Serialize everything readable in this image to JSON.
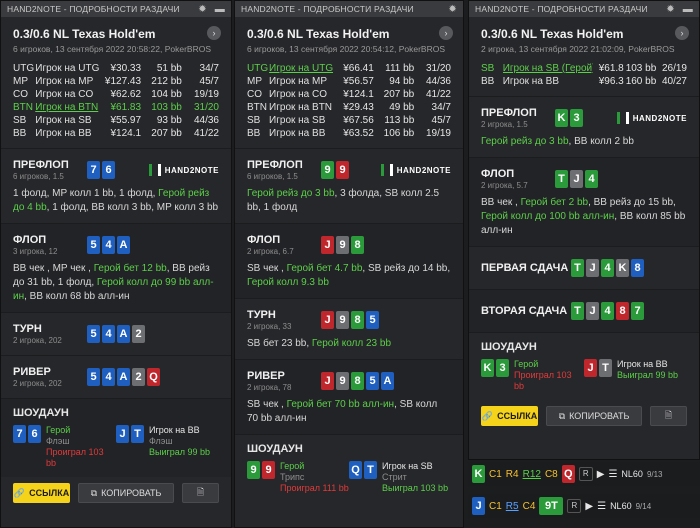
{
  "w1": {
    "title": "HAND2NOTE - ПОДРОБНОСТИ РАЗДАЧИ",
    "game": "0.3/0.6 NL Texas Hold'em",
    "meta": "6 игроков, 13 сентября 2022 20:58:22, PokerBROS",
    "players": [
      {
        "pos": "UTG",
        "name": "Игрок на UTG",
        "chips": "¥30.33",
        "bb": "51 bb",
        "stat": "34/7",
        "hero": false
      },
      {
        "pos": "MP",
        "name": "Игрок на MP",
        "chips": "¥127.43",
        "bb": "212 bb",
        "stat": "45/7",
        "hero": false
      },
      {
        "pos": "CO",
        "name": "Игрок на CO",
        "chips": "¥62.62",
        "bb": "104 bb",
        "stat": "19/19",
        "hero": false
      },
      {
        "pos": "BTN",
        "name": "Игрок на BTN",
        "chips": "¥61.83",
        "bb": "103 bb",
        "stat": "31/20",
        "hero": true
      },
      {
        "pos": "SB",
        "name": "Игрок на SB",
        "chips": "¥55.97",
        "bb": "93 bb",
        "stat": "44/36",
        "hero": false
      },
      {
        "pos": "BB",
        "name": "Игрок на BB",
        "chips": "¥124.1",
        "bb": "207 bb",
        "stat": "41/22",
        "hero": false
      }
    ],
    "preflop": {
      "label": "ПРЕФЛОП",
      "sub": "6 игроков, 1.5",
      "a1": "1 фолд, MP колл 1 bb, 1 фолд, ",
      "a2": "Герой рейз до 4 bb",
      "a3": ", 1 фолд, BB колл 3 bb, MP колл 3 bb"
    },
    "flop": {
      "label": "ФЛОП",
      "sub": "3 игрока, 12",
      "a1": "BB чек , MP чек , ",
      "a2": "Герой бет 12 bb",
      "a3": ", BB рейз до 31 bb, 1 фолд, ",
      "a4": "Герой колл до 99 bb алл-ин",
      "a5": ", BB колл 68 bb алл-ин"
    },
    "turn": {
      "label": "ТУРН",
      "sub": "2 игрока, 202"
    },
    "river": {
      "label": "РИВЕР",
      "sub": "2 игрока, 202"
    },
    "showdown": {
      "label": "ШОУДАУН",
      "hero": "Герой",
      "hero_hand": "Флэш",
      "hero_res": "Проиграл 103 bb",
      "opp": "Игрок на BB",
      "opp_hand": "Флэш",
      "opp_res": "Выиграл 99 bb"
    },
    "btn_link": "ССЫЛКА",
    "btn_copy": "КОПИРОВАТЬ"
  },
  "w2": {
    "title": "HAND2NOTE - ПОДРОБНОСТИ РАЗДАЧИ",
    "game": "0.3/0.6 NL Texas Hold'em",
    "meta": "6 игроков, 13 сентября 2022 20:54:12, PokerBROS",
    "players": [
      {
        "pos": "UTG",
        "name": "Игрок на UTG",
        "chips": "¥66.41",
        "bb": "111 bb",
        "stat": "31/20",
        "hero": true
      },
      {
        "pos": "MP",
        "name": "Игрок на MP",
        "chips": "¥56.57",
        "bb": "94 bb",
        "stat": "44/36",
        "hero": false
      },
      {
        "pos": "CO",
        "name": "Игрок на CO",
        "chips": "¥124.1",
        "bb": "207 bb",
        "stat": "41/22",
        "hero": false
      },
      {
        "pos": "BTN",
        "name": "Игрок на BTN",
        "chips": "¥29.43",
        "bb": "49 bb",
        "stat": "34/7",
        "hero": false
      },
      {
        "pos": "SB",
        "name": "Игрок на SB",
        "chips": "¥67.56",
        "bb": "113 bb",
        "stat": "45/7",
        "hero": false
      },
      {
        "pos": "BB",
        "name": "Игрок на BB",
        "chips": "¥63.52",
        "bb": "106 bb",
        "stat": "19/19",
        "hero": false
      }
    ],
    "preflop": {
      "label": "ПРЕФЛОП",
      "sub": "6 игроков, 1.5",
      "a1": "Герой рейз до 3 bb",
      "a2": ", 3 фолда, SB колл 2.5 bb, 1 фолд"
    },
    "flop": {
      "label": "ФЛОП",
      "sub": "2 игрока, 6.7",
      "a1": "SB чек , ",
      "a2": "Герой бет 4.7 bb",
      "a3": ", SB рейз до 14 bb, ",
      "a4": "Герой колл 9.3 bb"
    },
    "turn": {
      "label": "ТУРН",
      "sub": "2 игрока, 33",
      "a1": "SB бет 23 bb, ",
      "a2": "Герой колл 23 bb"
    },
    "river": {
      "label": "РИВЕР",
      "sub": "2 игрока, 78",
      "a1": "SB чек , ",
      "a2": "Герой бет 70 bb алл-ин",
      "a3": ", SB колл 70 bb алл-ин"
    },
    "showdown": {
      "label": "ШОУДАУН",
      "hero": "Герой",
      "hero_hand": "Трипс",
      "hero_res": "Проиграл 111 bb",
      "opp": "Игрок на SB",
      "opp_hand": "Стрит",
      "opp_res": "Выиграл 103 bb"
    }
  },
  "w3": {
    "title": "HAND2NOTE - ПОДРОБНОСТИ РАЗДАЧИ",
    "game": "0.3/0.6 NL Texas Hold'em",
    "meta": "2 игрока, 13 сентября 2022 21:02:09, PokerBROS",
    "players": [
      {
        "pos": "SB",
        "name": "Игрок на SB (Герой)",
        "chips": "¥61.8",
        "bb": "103 bb",
        "stat": "26/19",
        "hero": true
      },
      {
        "pos": "BB",
        "name": "Игрок на BB",
        "chips": "¥96.3",
        "bb": "160 bb",
        "stat": "40/27",
        "hero": false
      }
    ],
    "preflop": {
      "label": "ПРЕФЛОП",
      "sub": "2 игрока, 1.5",
      "a1": "Герой рейз до 3 bb",
      "a2": ", BB колл 2 bb"
    },
    "flop": {
      "label": "ФЛОП",
      "sub": "2 игрока, 5.7",
      "a1": "BB чек , ",
      "a2": "Герой бет 2 bb",
      "a3": ", BB рейз до 15 bb, ",
      "a4": "Герой колл до 100 bb алл-ин",
      "a5": ", BB колл 85 bb алл-ин"
    },
    "run1": "ПЕРВАЯ СДАЧА",
    "run2": "ВТОРАЯ СДАЧА",
    "showdown": {
      "label": "ШОУДАУН",
      "hero": "Герой",
      "hero_res": "Проиграл 103 bb",
      "opp": "Игрок на BB",
      "opp_res": "Выиграл 99 bb"
    },
    "btn_link": "ССЫЛКА",
    "btn_copy": "КОПИРОВАТЬ"
  },
  "strip": [
    {
      "a": "C1",
      "b": "R4",
      "c": "R12",
      "d": "C8",
      "limit": "NL60",
      "count": "9/13"
    },
    {
      "a": "C1",
      "b": "R5",
      "c": "C4",
      "d": "9T",
      "limit": "NL60",
      "count": "9/14"
    }
  ],
  "logo": "HAND2NOTE"
}
